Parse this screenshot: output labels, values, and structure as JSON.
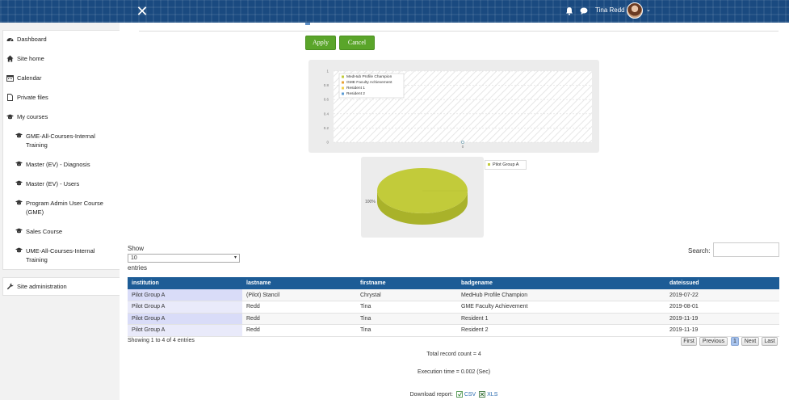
{
  "navbar": {
    "close_glyph": "✕",
    "user_name": "Tina Redd",
    "caret": "⌄",
    "icons": [
      "bell-icon",
      "chat-icon",
      "close-icon"
    ]
  },
  "sidebar": {
    "top_items": [
      {
        "label": "Dashboard",
        "icon": "dashboard-icon"
      },
      {
        "label": "Site home",
        "icon": "home-icon"
      },
      {
        "label": "Calendar",
        "icon": "calendar-icon"
      },
      {
        "label": "Private files",
        "icon": "file-icon"
      },
      {
        "label": "My courses",
        "icon": "graduation-cap-icon"
      }
    ],
    "courses": [
      {
        "label": "GME-All-Courses-Internal Training"
      },
      {
        "label": "Master (EV) - Diagnosis"
      },
      {
        "label": "Master (EV) - Users"
      },
      {
        "label": "Program Admin User Course (GME)"
      },
      {
        "label": "Sales Course"
      },
      {
        "label": "UME-All-Courses-Internal Training"
      }
    ],
    "admin": {
      "label": "Site administration",
      "icon": "wrench-icon"
    }
  },
  "buttons": {
    "apply": "Apply",
    "cancel": "Cancel"
  },
  "line_chart_legend": [
    "MedHub Profile Champion",
    "GME Faculty Achievement",
    "Resident 1",
    "Resident 2"
  ],
  "colors": {
    "accent_green": "#5aa52a",
    "table_header": "#1d5c96",
    "pie": "#c2cb3a",
    "legend": [
      "#c2cb3a",
      "#e8a33a",
      "#f2d14a",
      "#5b9bd5"
    ]
  },
  "chart_data": [
    {
      "type": "line",
      "series": [
        {
          "name": "MedHub Profile Champion",
          "values": [
            0
          ]
        },
        {
          "name": "GME Faculty Achievement",
          "values": [
            0
          ]
        },
        {
          "name": "Resident 1",
          "values": [
            0
          ]
        },
        {
          "name": "Resident 2",
          "values": [
            0
          ]
        }
      ],
      "categories": [
        "0"
      ],
      "yticks": [
        "0",
        "0.2",
        "0.4",
        "0.6",
        "0.8",
        "1"
      ],
      "ylim": [
        0,
        1
      ],
      "grid": true,
      "legend_position": "top-left"
    },
    {
      "type": "pie",
      "slices": [
        {
          "name": "Pilot Group A",
          "value": 100,
          "label": "100%"
        }
      ],
      "legend_position": "right"
    }
  ],
  "table": {
    "show_label": "Show",
    "page_size": "10",
    "entries_label": "entries",
    "search_label": "Search:",
    "columns": [
      "institution",
      "lastname",
      "firstname",
      "badgename",
      "dateissued"
    ],
    "rows": [
      [
        "Pilot Group A",
        "(Pilot) Stancil",
        "Chrystal",
        "MedHub Profile Champion",
        "2019-07-22"
      ],
      [
        "Pilot Group A",
        "Redd",
        "Tina",
        "GME Faculty Achievement",
        "2019-08-01"
      ],
      [
        "Pilot Group A",
        "Redd",
        "Tina",
        "Resident 1",
        "2019-11-19"
      ],
      [
        "Pilot Group A",
        "Redd",
        "Tina",
        "Resident 2",
        "2019-11-19"
      ]
    ],
    "showing_text": "Showing 1 to 4 of 4 entries",
    "pagination": {
      "first": "First",
      "previous": "Previous",
      "current": "1",
      "next": "Next",
      "last": "Last"
    }
  },
  "footer": {
    "record_count": "Total record count = 4",
    "execution_time": "Execution time = 0.002 (Sec)",
    "download_label": "Download report:",
    "csv": "CSV",
    "xls": "XLS"
  }
}
